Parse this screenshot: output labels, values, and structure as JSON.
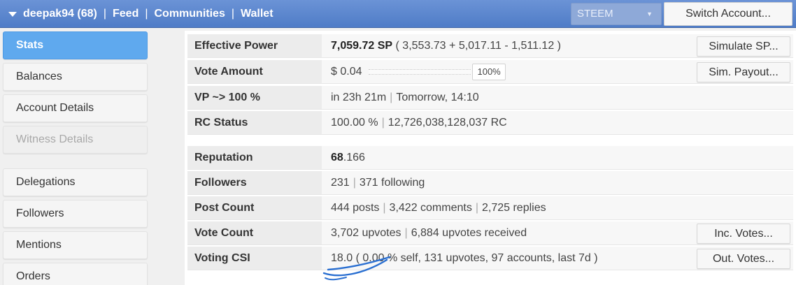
{
  "topbar": {
    "account": "deepak94 (68)",
    "separator": "|",
    "nav": [
      "Feed",
      "Communities",
      "Wallet"
    ],
    "currency": "STEEM",
    "switch_label": "Switch Account..."
  },
  "sidebar": {
    "items": [
      {
        "label": "Stats"
      },
      {
        "label": "Balances"
      },
      {
        "label": "Account Details"
      },
      {
        "label": "Witness Details"
      },
      {
        "label": "Delegations"
      },
      {
        "label": "Followers"
      },
      {
        "label": "Mentions"
      },
      {
        "label": "Orders"
      }
    ]
  },
  "stats": {
    "sep": "|",
    "effective_power": {
      "label": "Effective Power",
      "main": "7,059.72 SP",
      "detail": " ( 3,553.73 + 5,017.11 - 1,511.12 )",
      "button": "Simulate SP..."
    },
    "vote_amount": {
      "label": "Vote Amount",
      "value": "$ 0.04",
      "percent": "100%",
      "percent_value": 100,
      "button": "Sim. Payout..."
    },
    "vp": {
      "label": "VP ~> 100 %",
      "time": "in 23h 21m",
      "when": "Tomorrow, 14:10"
    },
    "rc": {
      "label": "RC Status",
      "percent": "100.00 %",
      "amount": "12,726,038,128,037 RC"
    },
    "reputation": {
      "label": "Reputation",
      "whole": "68",
      "fraction": ".166"
    },
    "followers": {
      "label": "Followers",
      "count": "231",
      "following": "371 following"
    },
    "post_count": {
      "label": "Post Count",
      "posts": "444 posts",
      "comments": "3,422 comments",
      "replies": "2,725 replies"
    },
    "vote_count": {
      "label": "Vote Count",
      "upvotes": "3,702 upvotes",
      "received": "6,884 upvotes received",
      "button": "Inc. Votes..."
    },
    "voting_csi": {
      "label": "Voting CSI",
      "value": "18.0 ( 0.00 % self, 131 upvotes, 97 accounts, last 7d )",
      "button": "Out. Votes..."
    }
  }
}
